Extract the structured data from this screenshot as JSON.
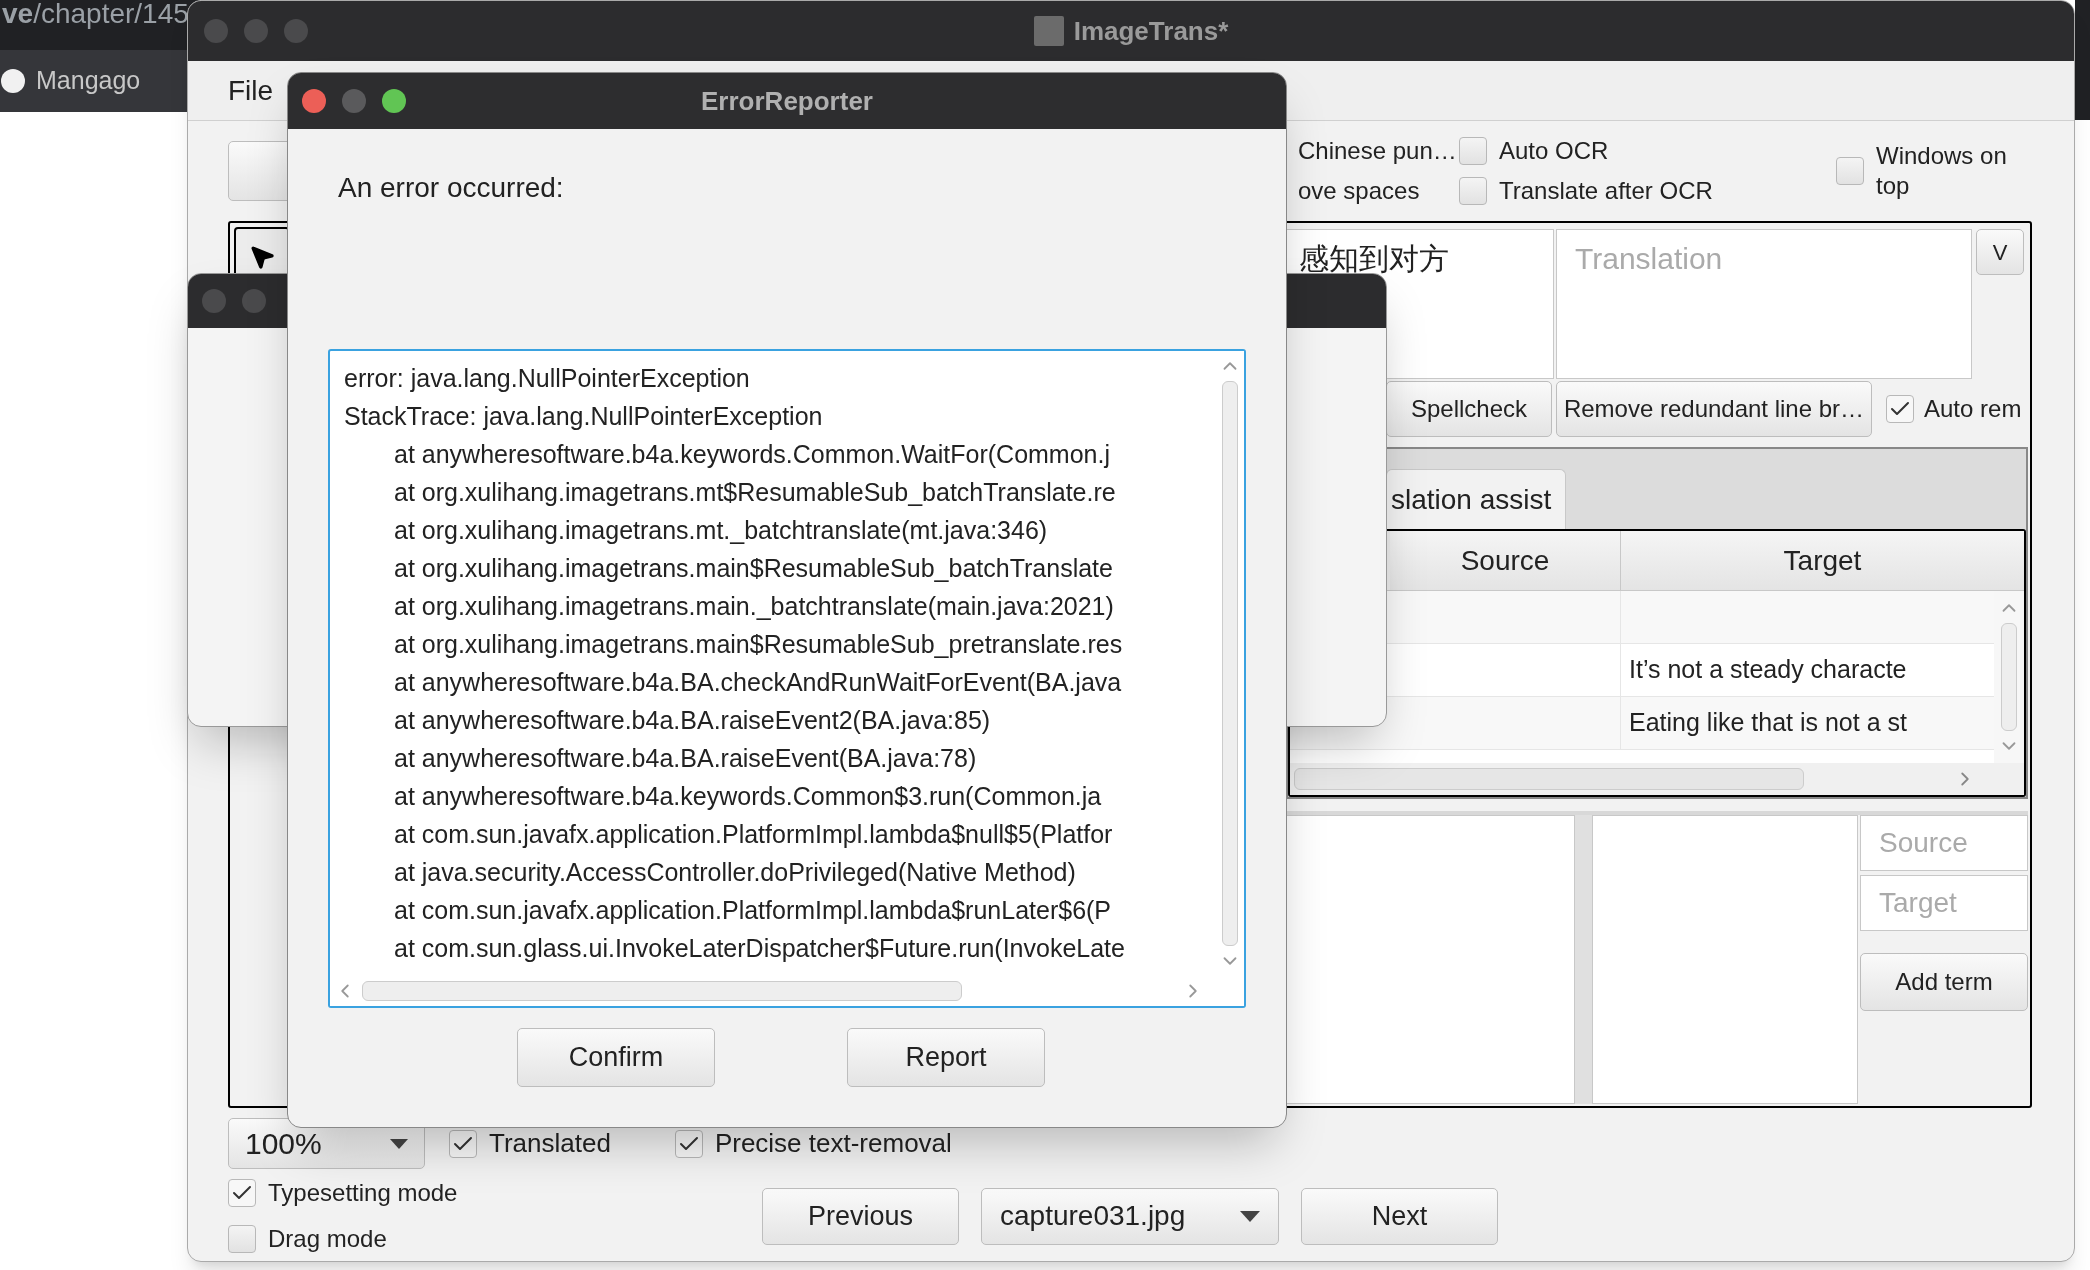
{
  "browser": {
    "address": "**ve**/chapter/145",
    "tab_title": "Mangago"
  },
  "main_window": {
    "title": "ImageTrans*",
    "menu": [
      {
        "label": "File"
      }
    ],
    "options": [
      {
        "kind": "label",
        "label": "Chinese pun…"
      },
      {
        "kind": "label",
        "label": "ove spaces"
      },
      {
        "kind": "checkbox",
        "label": "Auto OCR",
        "checked": false
      },
      {
        "kind": "checkbox",
        "label": "Translate after OCR",
        "checked": false
      }
    ],
    "windows_on_top": {
      "label": "Windows on top",
      "checked": false
    },
    "editor": {
      "source_text": "感知到对方",
      "translation_placeholder": "Translation",
      "expand_button": "V",
      "buttons": [
        "Spellcheck",
        "Remove redundant line br…"
      ],
      "auto_remove": {
        "label": "Auto rem",
        "checked": true
      }
    },
    "tabs": [
      {
        "label": "slation assist",
        "selected": true
      }
    ],
    "table": {
      "columns": [
        "Source",
        "Target"
      ],
      "rows": [
        {
          "kind": "empty"
        },
        {
          "kind": "entry",
          "target": "It’s not a steady characte"
        },
        {
          "kind": "entry",
          "target": "Eating like that is not a st"
        }
      ]
    },
    "term_form": {
      "source_placeholder": "Source",
      "target_placeholder": "Target",
      "button": "Add term"
    },
    "footer": {
      "zoom": "100%",
      "checkboxes": [
        {
          "label": "Translated",
          "checked": true
        },
        {
          "label": "Precise text-removal",
          "checked": true
        },
        {
          "label": "Typesetting mode",
          "checked": true
        },
        {
          "label": "Drag mode",
          "checked": false
        }
      ],
      "previous": "Previous",
      "file": "capture031.jpg",
      "next": "Next"
    }
  },
  "error_dialog": {
    "title": "ErrorReporter",
    "message": "An error occurred:",
    "trace": [
      {
        "text": "error: java.lang.NullPointerException",
        "indented": false
      },
      {
        "text": "StackTrace: java.lang.NullPointerException",
        "indented": false
      },
      {
        "text": "at anywheresoftware.b4a.keywords.Common.WaitFor(Common.j",
        "indented": true
      },
      {
        "text": "at org.xulihang.imagetrans.mt$ResumableSub_batchTranslate.re",
        "indented": true
      },
      {
        "text": "at org.xulihang.imagetrans.mt._batchtranslate(mt.java:346)",
        "indented": true
      },
      {
        "text": "at org.xulihang.imagetrans.main$ResumableSub_batchTranslate",
        "indented": true
      },
      {
        "text": "at org.xulihang.imagetrans.main._batchtranslate(main.java:2021)",
        "indented": true
      },
      {
        "text": "at org.xulihang.imagetrans.main$ResumableSub_pretranslate.res",
        "indented": true
      },
      {
        "text": "at anywheresoftware.b4a.BA.checkAndRunWaitForEvent(BA.java",
        "indented": true
      },
      {
        "text": "at anywheresoftware.b4a.BA.raiseEvent2(BA.java:85)",
        "indented": true
      },
      {
        "text": "at anywheresoftware.b4a.BA.raiseEvent(BA.java:78)",
        "indented": true
      },
      {
        "text": "at anywheresoftware.b4a.keywords.Common$3.run(Common.ja",
        "indented": true
      },
      {
        "text": "at com.sun.javafx.application.PlatformImpl.lambda$null$5(Platfor",
        "indented": true
      },
      {
        "text": "at java.security.AccessController.doPrivileged(Native Method)",
        "indented": true
      },
      {
        "text": "at com.sun.javafx.application.PlatformImpl.lambda$runLater$6(P",
        "indented": true
      },
      {
        "text": "at com.sun.glass.ui.InvokeLaterDispatcher$Future.run(InvokeLate",
        "indented": true
      }
    ],
    "buttons": [
      "Confirm",
      "Report"
    ]
  }
}
